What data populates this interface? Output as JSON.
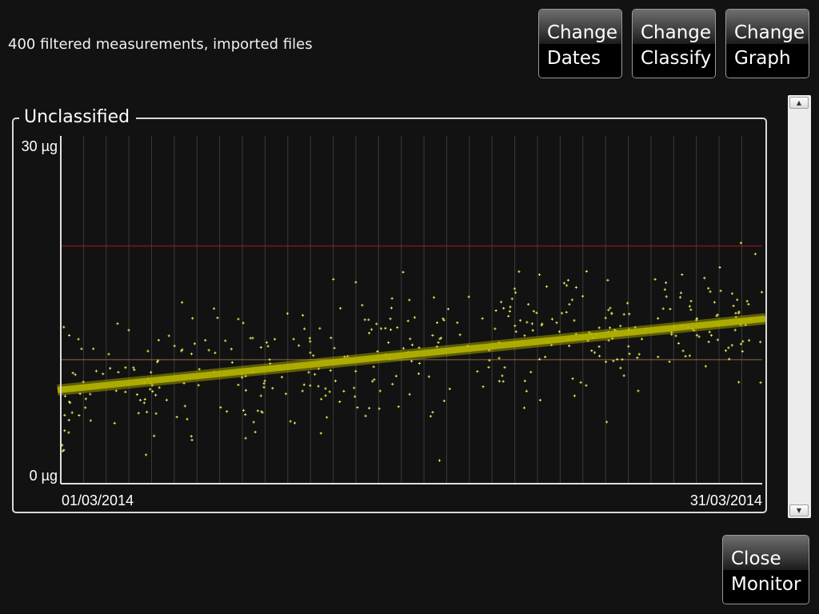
{
  "status": {
    "text": "400 filtered measurements, imported files"
  },
  "buttons": {
    "change_dates": {
      "top": "Change",
      "bottom": "Dates"
    },
    "change_classify": {
      "top": "Change",
      "bottom": "Classify"
    },
    "change_graph": {
      "top": "Change",
      "bottom": "Graph"
    },
    "close_monitor": {
      "top": "Close",
      "bottom": "Monitor"
    }
  },
  "scrollbar": {
    "up_icon": "triangle-up",
    "down_icon": "triangle-down"
  },
  "colors": {
    "background": "#121212",
    "points": "#e6e65a",
    "trend": "#b8b800",
    "upper_limit": "#b31414",
    "mid_line": "#8a6a40",
    "grid": "#3a3a3a",
    "axis": "#e0e0e0"
  },
  "chart_data": {
    "type": "scatter",
    "title": "Unclassified",
    "ylim": [
      0,
      30
    ],
    "ytick_labels": {
      "top": "30 µg",
      "bottom": "0 µg"
    },
    "x_start_label": "01/03/2014",
    "x_end_label": "31/03/2014",
    "x_range_days": [
      1,
      31.9
    ],
    "n_points": 400,
    "upper_threshold": 20.5,
    "lower_threshold": 10.7,
    "trend": {
      "start": 8.1,
      "end": 14.2
    },
    "grid": "vertical",
    "points_generator": {
      "note": "400 points scattered around the trend line; values approximate the visible cloud",
      "seed": 12345,
      "spread": 5.2
    }
  }
}
